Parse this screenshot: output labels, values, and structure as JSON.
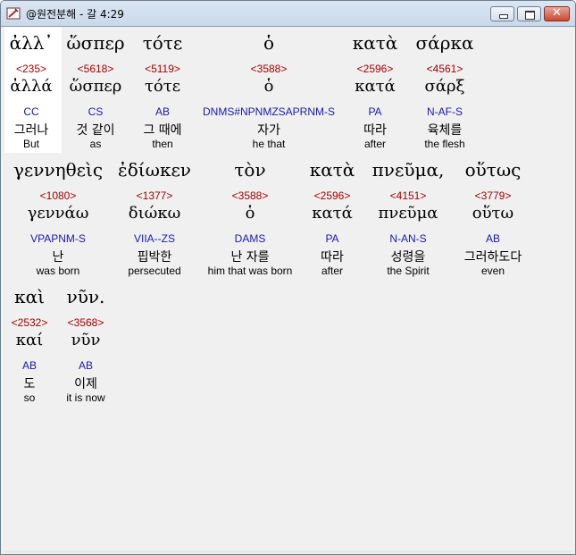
{
  "window": {
    "title": "@원전분해 - 갈 4:29",
    "controls": {
      "minimize_icon": "minimize-icon",
      "maximize_icon": "maximize-icon",
      "close_label": "✕"
    }
  },
  "rows": [
    [
      {
        "greek": "ἀλλ᾽",
        "strongs": "<235>",
        "lemma": "ἀλλά",
        "parsing": "CC",
        "korean": "그러나",
        "english": "But"
      },
      {
        "greek": "ὥσπερ",
        "strongs": "<5618>",
        "lemma": "ὥσπερ",
        "parsing": "CS",
        "korean": "것 같이",
        "english": "as"
      },
      {
        "greek": "τότε",
        "strongs": "<5119>",
        "lemma": "τότε",
        "parsing": "AB",
        "korean": "그 때에",
        "english": "then"
      },
      {
        "greek": "ὁ",
        "strongs": "<3588>",
        "lemma": "ὁ",
        "parsing": "DNMS#NPNMZSAPRNM-S",
        "korean": "자가",
        "english": "he that"
      },
      {
        "greek": "κατὰ",
        "strongs": "<2596>",
        "lemma": "κατά",
        "parsing": "PA",
        "korean": "따라",
        "english": "after"
      },
      {
        "greek": "σάρκα",
        "strongs": "<4561>",
        "lemma": "σάρξ",
        "parsing": "N-AF-S",
        "korean": "육체를",
        "english": "the flesh"
      }
    ],
    [
      {
        "greek": "γεννηθεὶς",
        "strongs": "<1080>",
        "lemma": "γεννάω",
        "parsing": "VPAPNM-S",
        "korean": "난",
        "english": "was born"
      },
      {
        "greek": "ἐδίωκεν",
        "strongs": "<1377>",
        "lemma": "διώκω",
        "parsing": "VIIA--ZS",
        "korean": "핍박한",
        "english": "persecuted"
      },
      {
        "greek": "τὸν",
        "strongs": "<3588>",
        "lemma": "ὁ",
        "parsing": "DAMS",
        "korean": "난 자를",
        "english": "him that was born"
      },
      {
        "greek": "κατὰ",
        "strongs": "<2596>",
        "lemma": "κατά",
        "parsing": "PA",
        "korean": "따라",
        "english": "after"
      },
      {
        "greek": "πνεῦμα,",
        "strongs": "<4151>",
        "lemma": "πνεῦμα",
        "parsing": "N-AN-S",
        "korean": "성령을",
        "english": "the Spirit"
      },
      {
        "greek": "οὕτως",
        "strongs": "<3779>",
        "lemma": "οὕτω",
        "parsing": "AB",
        "korean": "그러하도다",
        "english": "even"
      }
    ],
    [
      {
        "greek": "καὶ",
        "strongs": "<2532>",
        "lemma": "καί",
        "parsing": "AB",
        "korean": "도",
        "english": "so"
      },
      {
        "greek": "νῦν.",
        "strongs": "<3568>",
        "lemma": "νῦν",
        "parsing": "AB",
        "korean": "이제",
        "english": "it is now"
      }
    ]
  ]
}
